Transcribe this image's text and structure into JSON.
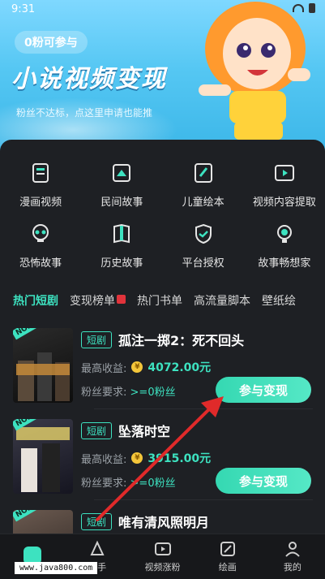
{
  "status": {
    "time": "9:31"
  },
  "banner": {
    "pill": "0粉可参与",
    "title": "小说视频变现",
    "subtitle": "粉丝不达标，点这里申请也能推"
  },
  "menu": [
    {
      "label": "漫画视频",
      "icon": "comic-video-icon"
    },
    {
      "label": "民间故事",
      "icon": "folk-story-icon"
    },
    {
      "label": "儿童绘本",
      "icon": "kids-book-icon"
    },
    {
      "label": "视频内容提取",
      "icon": "video-extract-icon"
    },
    {
      "label": "恐怖故事",
      "icon": "skull-icon"
    },
    {
      "label": "历史故事",
      "icon": "history-book-icon"
    },
    {
      "label": "平台授权",
      "icon": "shield-icon"
    },
    {
      "label": "故事畅想家",
      "icon": "bulb-icon"
    }
  ],
  "tabs": [
    {
      "label": "热门短剧",
      "active": true
    },
    {
      "label": "变现榜单"
    },
    {
      "label": "热门书单"
    },
    {
      "label": "高流量脚本"
    },
    {
      "label": "壁纸绘"
    }
  ],
  "cards": [
    {
      "rank": "NO.1",
      "tag": "短剧",
      "title": "孤注一掷2：死不回头",
      "income_label": "最高收益:",
      "income": "4072.00元",
      "fans_label": "粉丝要求:",
      "fans": ">=0粉丝",
      "button": "参与变现"
    },
    {
      "rank": "NO.2",
      "tag": "短剧",
      "title": "坠落时空",
      "income_label": "最高收益:",
      "income": "3915.00元",
      "fans_label": "粉丝要求:",
      "fans": ">=0粉丝",
      "button": "参与变现"
    },
    {
      "rank": "NO.3",
      "tag": "短剧",
      "title": "唯有清风照明月"
    }
  ],
  "nav": [
    {
      "label": "",
      "icon": "home-icon",
      "active": true
    },
    {
      "label": "助手",
      "icon": "assistant-icon"
    },
    {
      "label": "视频涨粉",
      "icon": "video-icon"
    },
    {
      "label": "绘画",
      "icon": "paint-icon"
    },
    {
      "label": "我的",
      "icon": "profile-icon"
    }
  ],
  "watermark": "www.java800.com",
  "colors": {
    "accent": "#3de2c0",
    "bg": "#1e2024"
  }
}
